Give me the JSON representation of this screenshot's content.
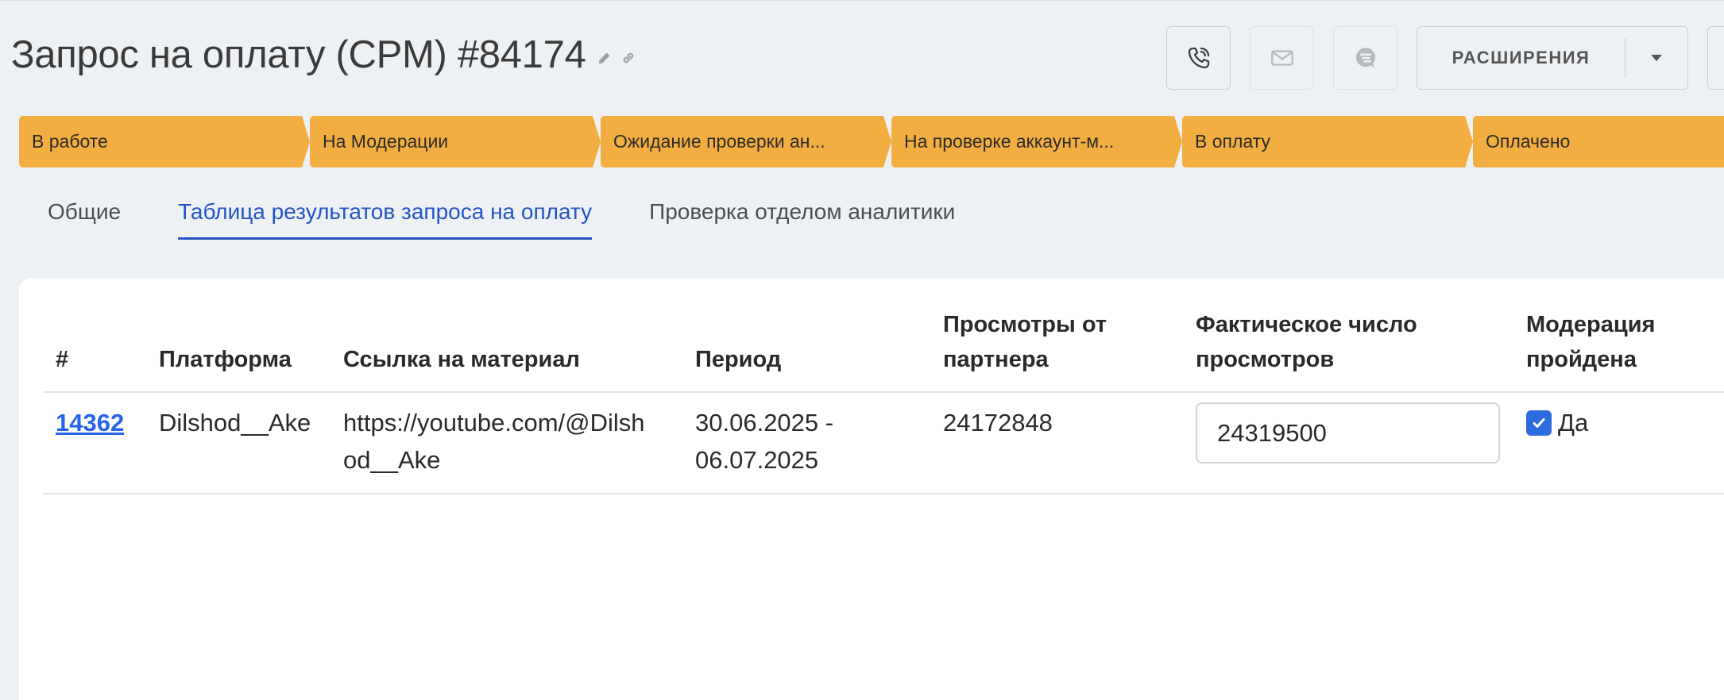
{
  "header": {
    "title": "Запрос на оплату (CPM) #84174"
  },
  "toolbar": {
    "call_icon": "phone-icon",
    "mail_icon": "mail-icon",
    "chat_icon": "chat-icon",
    "extensions_label": "РАСШИРЕНИЯ"
  },
  "stages": [
    {
      "label": "В работе"
    },
    {
      "label": "На Модерации"
    },
    {
      "label": "Ожидание проверки ан..."
    },
    {
      "label": "На проверке аккаунт-м..."
    },
    {
      "label": "В оплату"
    },
    {
      "label": "Оплачено"
    }
  ],
  "colors": {
    "stage": "#f2ae40",
    "accent": "#2454c4",
    "link": "#2563eb",
    "checkbox": "#2d6cdf"
  },
  "tabs": [
    {
      "label": "Общие",
      "active": false
    },
    {
      "label": "Таблица результатов запроса на оплату",
      "active": true
    },
    {
      "label": "Проверка отделом аналитики",
      "active": false
    }
  ],
  "table": {
    "headers": {
      "id": "#",
      "platform": "Платформа",
      "link": "Ссылка на материал",
      "period": "Период",
      "partner_views_1": "Просмотры от",
      "partner_views_2": "партнера",
      "actual_views_1": "Фактическое число",
      "actual_views_2": "просмотров",
      "moderation_1": "Модерация",
      "moderation_2": "пройдена"
    },
    "rows": [
      {
        "id": "14362",
        "platform": "Dilshod__Ake",
        "link_1": "https://youtube.com/@Dilsh",
        "link_2": "od__Ake",
        "period_1": "30.06.2025 -",
        "period_2": "06.07.2025",
        "partner_views": "24172848",
        "actual_views": "24319500",
        "moderation_checked": true,
        "moderation_label": "Да"
      }
    ]
  }
}
